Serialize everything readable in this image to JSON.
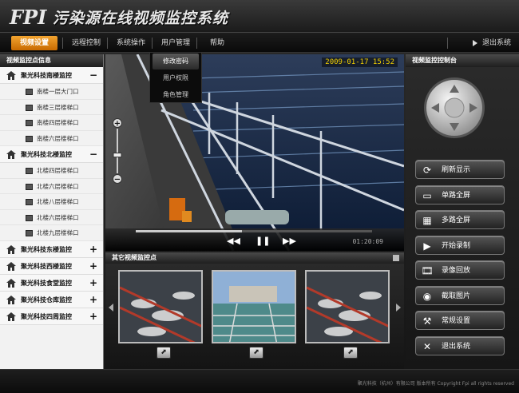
{
  "app": {
    "logo_text": "FPI",
    "title": "污染源在线视频监控系统"
  },
  "menu": {
    "items": [
      {
        "label": "视频设置"
      },
      {
        "label": "远程控制"
      },
      {
        "label": "系统操作"
      },
      {
        "label": "用户管理"
      },
      {
        "label": "帮助"
      }
    ],
    "logout": "退出系统"
  },
  "dropdown": {
    "items": [
      {
        "label": "修改密码"
      },
      {
        "label": "用户权限"
      },
      {
        "label": "角色管理"
      }
    ]
  },
  "left_panel": {
    "title": "视频监控点信息",
    "groups": [
      {
        "name": "聚光科技南楼监控",
        "toggle": "−",
        "cameras": [
          "南楼一层大门口",
          "南楼三层楼梯口",
          "南楼四层楼梯口",
          "南楼六层楼梯口"
        ]
      },
      {
        "name": "聚光科技北楼监控",
        "toggle": "−",
        "cameras": [
          "北楼四层楼梯口",
          "北楼六层楼梯口",
          "北楼八层楼梯口",
          "北楼六层楼梯口",
          "北楼九层楼梯口"
        ]
      },
      {
        "name": "聚光科技东楼监控",
        "toggle": "+",
        "cameras": []
      },
      {
        "name": "聚光科技西楼监控",
        "toggle": "+",
        "cameras": []
      },
      {
        "name": "聚光科技食堂监控",
        "toggle": "+",
        "cameras": []
      },
      {
        "name": "聚光科技仓库监控",
        "toggle": "+",
        "cameras": []
      },
      {
        "name": "聚光科技四周监控",
        "toggle": "+",
        "cameras": []
      }
    ]
  },
  "video": {
    "timestamp": "2009-01-17 15:52",
    "elapsed": "01:20:09",
    "progress": 0.45,
    "zoom_level": 0.4
  },
  "others": {
    "title": "其它视频监控点"
  },
  "right_panel": {
    "title": "视频监控控制台",
    "buttons": [
      {
        "label": "刷新显示",
        "icon": "refresh-icon"
      },
      {
        "label": "单路全屏",
        "icon": "single-screen-icon"
      },
      {
        "label": "多路全屏",
        "icon": "multi-screen-icon"
      },
      {
        "label": "开始录制",
        "icon": "record-icon"
      },
      {
        "label": "录像回放",
        "icon": "playback-icon"
      },
      {
        "label": "截取图片",
        "icon": "camera-icon"
      },
      {
        "label": "常规设置",
        "icon": "wrench-icon"
      },
      {
        "label": "退出系统",
        "icon": "close-icon"
      }
    ]
  },
  "footer": {
    "text": "聚光科技（杭州）有限公司 版本所有 Copyright Fpi all rights reserved"
  },
  "colors": {
    "accent": "#e08a10",
    "timestamp": "#f2d000"
  }
}
